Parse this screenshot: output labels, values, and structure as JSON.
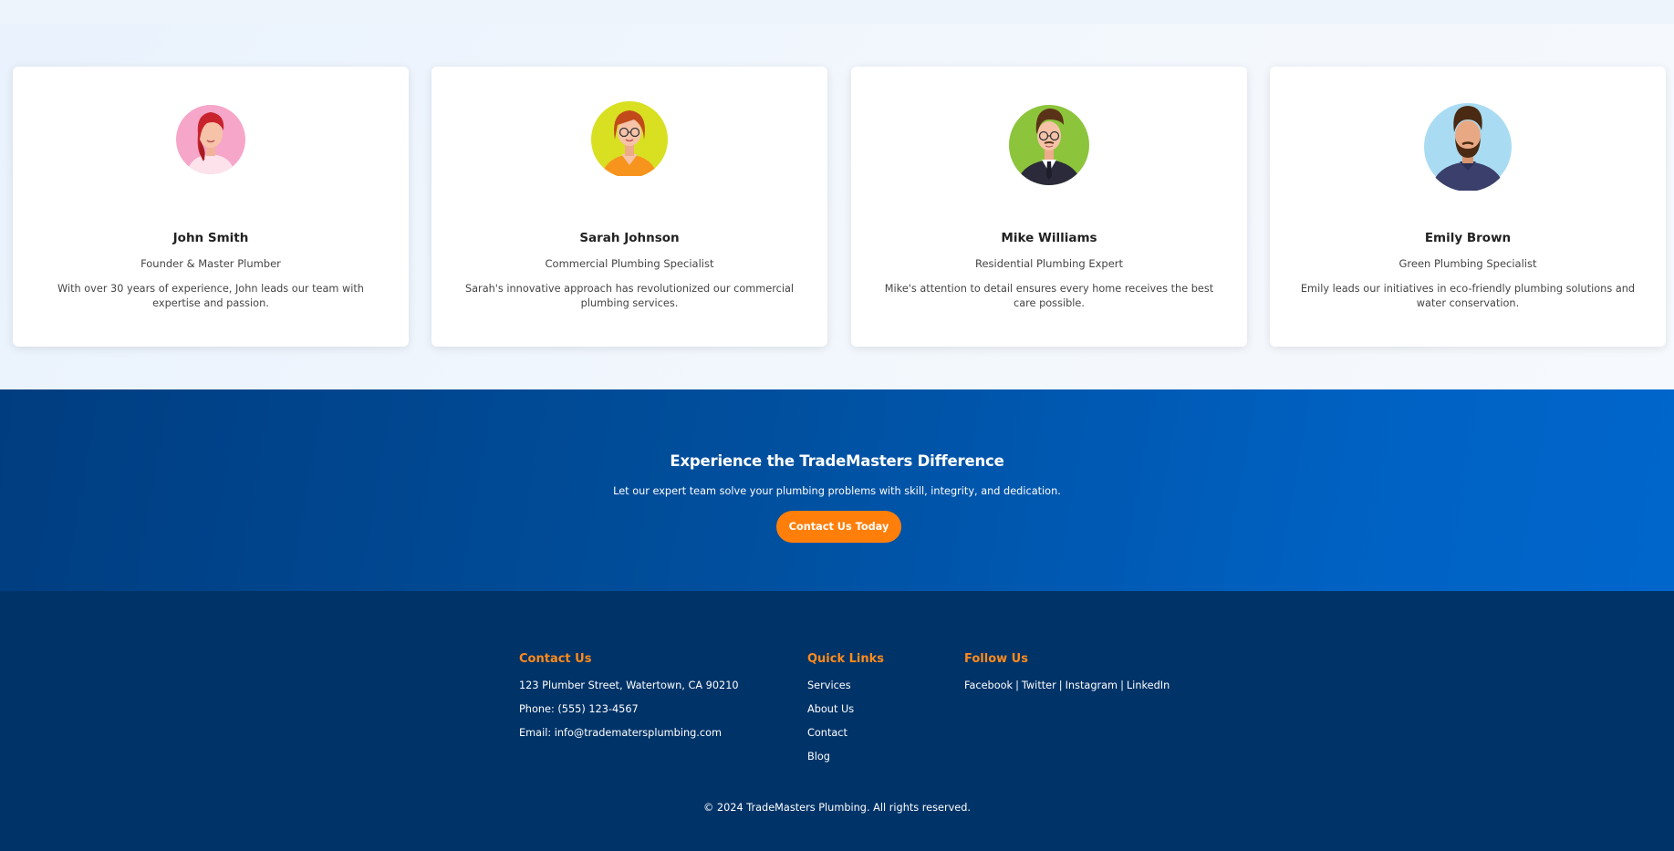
{
  "team": [
    {
      "name": "John Smith",
      "role": "Founder & Master Plumber",
      "bio": "With over 30 years of experience, John leads our team with expertise and passion.",
      "avatar_icon": "woman-red-hair-avatar-icon",
      "avatar_bg": "#f6a6c9"
    },
    {
      "name": "Sarah Johnson",
      "role": "Commercial Plumbing Specialist",
      "bio": "Sarah's innovative approach has revolutionized our commercial plumbing services.",
      "avatar_icon": "woman-glasses-avatar-icon",
      "avatar_bg": "#d8e021"
    },
    {
      "name": "Mike Williams",
      "role": "Residential Plumbing Expert",
      "bio": "Mike's attention to detail ensures every home receives the best care possible.",
      "avatar_icon": "man-glasses-suit-avatar-icon",
      "avatar_bg": "#8cc43c"
    },
    {
      "name": "Emily Brown",
      "role": "Green Plumbing Specialist",
      "bio": "Emily leads our initiatives in eco-friendly plumbing solutions and water conservation.",
      "avatar_icon": "man-beard-avatar-icon",
      "avatar_bg": "#a9dcf3"
    }
  ],
  "cta": {
    "title": "Experience the TradeMasters Difference",
    "subtitle": "Let our expert team solve your plumbing problems with skill, integrity, and dedication.",
    "button_label": "Contact Us Today"
  },
  "footer": {
    "contact": {
      "heading": "Contact Us",
      "address": "123 Plumber Street, Watertown, CA 90210",
      "phone": "Phone: (555) 123-4567",
      "email": "Email: info@tradematersplumbing.com"
    },
    "quick_links": {
      "heading": "Quick Links",
      "items": [
        "Services",
        "About Us",
        "Contact",
        "Blog"
      ]
    },
    "follow": {
      "heading": "Follow Us",
      "items": [
        "Facebook",
        "Twitter",
        "Instagram",
        "LinkedIn"
      ],
      "separator": "|"
    },
    "copyright": "© 2024 TradeMasters Plumbing. All rights reserved."
  },
  "colors": {
    "accent": "#ff7f0a",
    "cta_start": "#003d80",
    "cta_end": "#0066cc",
    "footer_bg": "#003368",
    "footer_heading": "#ff8a1a"
  }
}
